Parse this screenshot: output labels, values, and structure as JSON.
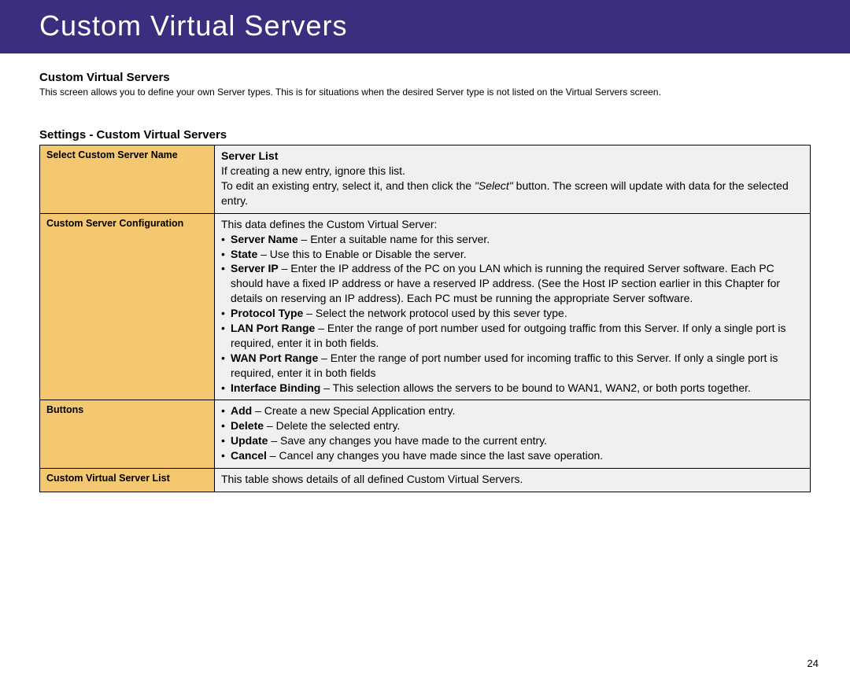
{
  "banner": "Custom Virtual Servers",
  "title": "Custom Virtual Servers",
  "desc": "This screen allows you to define your own Server types. This is for situations when the desired Server type is not listed on the Virtual Servers screen.",
  "settings_title": "Settings - Custom Virtual Servers",
  "rows": {
    "r1_label": "Select Custom Server Name",
    "r1_head": "Server List",
    "r1_line1": "If creating a new entry, ignore this list.",
    "r1_line2a": "To edit an existing entry, select it, and then click the ",
    "r1_line2_em": "\"Select\"",
    "r1_line2b": " button. The screen will update with data for the selected entry.",
    "r2_label": "Custom Server Configuration",
    "r2_intro": "This data defines the Custom Virtual Server:",
    "r2_sn_b": "Server Name",
    "r2_sn_t": " – Enter a suitable name for this server.",
    "r2_state_b": "State",
    "r2_state_t": " – Use this to Enable or Disable the server.",
    "r2_ip_b": "Server IP",
    "r2_ip_t": " – Enter the IP address of the PC on you LAN which is running the required Server software. Each PC should have a fixed IP address or have a reserved IP address. (See the Host IP section earlier in this Chapter for details on reserving an IP address). Each PC must be running the appropriate Server software.",
    "r2_proto_b": "Protocol Type",
    "r2_proto_t": " – Select the network protocol used by this sever type.",
    "r2_lan_b": "LAN Port Range",
    "r2_lan_t": " – Enter the range of port number used for outgoing traffic from this Server. If only a single port is required, enter it in both fields.",
    "r2_wan_b": "WAN Port Range",
    "r2_wan_t": " – Enter the range of port number used for incoming traffic to this Server. If only a single port is required, enter it in both fields",
    "r2_if_b": "Interface Binding",
    "r2_if_t": " – This selection allows the servers to be bound to WAN1, WAN2, or both ports together.",
    "r3_label": "Buttons",
    "r3_add_b": "Add",
    "r3_add_t": " – Create a new Special Application entry.",
    "r3_del_b": "Delete",
    "r3_del_t": " – Delete the selected entry.",
    "r3_upd_b": "Update",
    "r3_upd_t": " – Save any changes you have made to the current entry.",
    "r3_can_b": "Cancel",
    "r3_can_t": " – Cancel any changes you have made since the last save operation.",
    "r4_label": "Custom Virtual Server List",
    "r4_text": "This table shows details of all defined Custom Virtual Servers."
  },
  "page_number": "24"
}
